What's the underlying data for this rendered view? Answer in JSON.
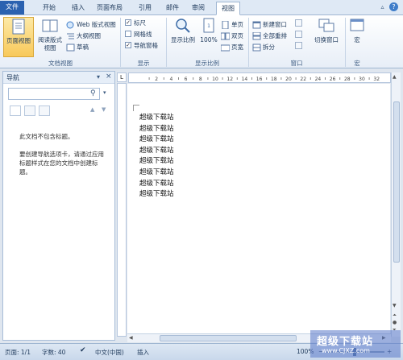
{
  "tabs": [
    {
      "label": "文件",
      "kind": "file"
    },
    {
      "label": "开始",
      "kind": "normal"
    },
    {
      "label": "插入",
      "kind": "normal"
    },
    {
      "label": "页面布局",
      "kind": "normal"
    },
    {
      "label": "引用",
      "kind": "normal"
    },
    {
      "label": "邮件",
      "kind": "normal"
    },
    {
      "label": "审阅",
      "kind": "normal"
    },
    {
      "label": "视图",
      "kind": "active"
    }
  ],
  "ribbon": {
    "views": {
      "page_view": "页面视图",
      "reading_view_1": "阅读版式",
      "reading_view_2": "视图",
      "web_view": "Web 版式视图",
      "outline": "大纲视图",
      "draft": "草稿",
      "group": "文档视图"
    },
    "show": {
      "ruler": "标尺",
      "gridlines": "网格线",
      "nav_pane": "导航窗格",
      "ruler_checked": true,
      "gridlines_checked": false,
      "nav_checked": true,
      "group": "显示"
    },
    "zoom": {
      "zoom": "显示比例",
      "hundred": "100%",
      "one_page": "单页",
      "two_pages": "双页",
      "page_width": "页宽",
      "group": "显示比例"
    },
    "window": {
      "new_window": "新建窗口",
      "arrange_all": "全部重排",
      "split": "拆分",
      "switch_window": "切换窗口",
      "group": "窗口"
    },
    "macros": {
      "macros": "宏",
      "group": "宏"
    }
  },
  "nav": {
    "title": "导航",
    "search_placeholder": "",
    "message_1": "此文档不包含标题。",
    "message_2": "要创建导航选项卡，请通过应用标题样式在您的文档中创建标题。"
  },
  "ruler_ticks": [
    "2",
    "4",
    "6",
    "8",
    "10",
    "12",
    "14",
    "16",
    "18",
    "20",
    "22",
    "24",
    "26",
    "28",
    "30",
    "32"
  ],
  "document": {
    "lines": [
      "超级下载站",
      "超级下载站",
      "超级下载站",
      "超级下载站",
      "超级下载站",
      "超级下载站",
      "超级下载站",
      "超级下载站"
    ]
  },
  "status": {
    "page": "页面: 1/1",
    "words": "字数: 40",
    "language": "中文(中国)",
    "mode": "插入",
    "zoom": "100%"
  },
  "watermark": {
    "title": "超级下载站",
    "url": "www.CJXZ.com"
  },
  "colors": {
    "file_tab": "#2b62b0",
    "ribbon_bg": "#e7eef7",
    "accent": "#1e395b"
  }
}
